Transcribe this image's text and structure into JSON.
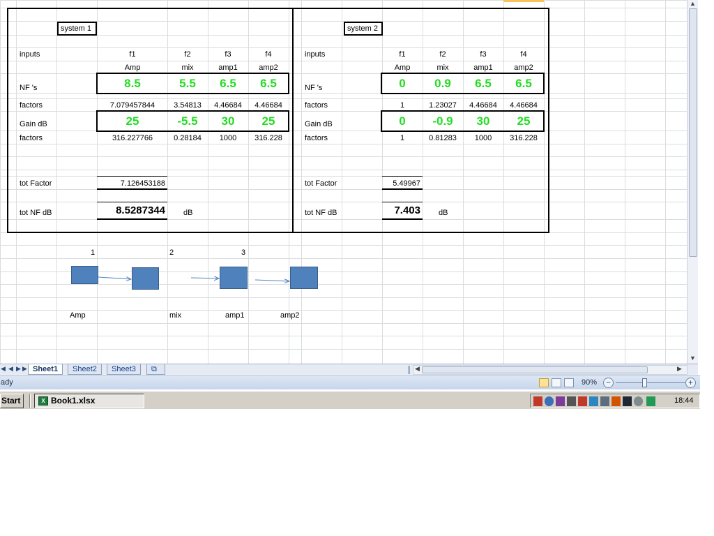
{
  "system1": {
    "title": "system 1",
    "inputs_label": "inputs",
    "headers": [
      "f1",
      "f2",
      "f3",
      "f4"
    ],
    "components": [
      "Amp",
      "mix",
      "amp1",
      "amp2"
    ],
    "nf_label": "NF 's",
    "nf_values": [
      "8.5",
      "5.5",
      "6.5",
      "6.5"
    ],
    "factors_label": "factors",
    "nf_factors": [
      "7.079457844",
      "3.54813",
      "4.46684",
      "4.46684"
    ],
    "gain_label": "Gain dB",
    "gain_values": [
      "25",
      "-5.5",
      "30",
      "25"
    ],
    "gain_factors": [
      "316.227766",
      "0.28184",
      "1000",
      "316.228"
    ],
    "tot_factor_label": "tot Factor",
    "tot_factor_value": "7.126453188",
    "tot_nf_label": "tot NF dB",
    "tot_nf_value": "8.5287344",
    "unit": "dB"
  },
  "system2": {
    "title": "system 2",
    "inputs_label": "inputs",
    "headers": [
      "f1",
      "f2",
      "f3",
      "f4"
    ],
    "components": [
      "Amp",
      "mix",
      "amp1",
      "amp2"
    ],
    "nf_label": "NF 's",
    "nf_values": [
      "0",
      "0.9",
      "6.5",
      "6.5"
    ],
    "factors_label": "factors",
    "nf_factors": [
      "1",
      "1.23027",
      "4.46684",
      "4.46684"
    ],
    "gain_label": "Gain dB",
    "gain_values": [
      "0",
      "-0.9",
      "30",
      "25"
    ],
    "gain_factors": [
      "1",
      "0.81283",
      "1000",
      "316.228"
    ],
    "tot_factor_label": "tot Factor",
    "tot_factor_value": "5.49967",
    "tot_nf_label": "tot NF dB",
    "tot_nf_value": "7.403",
    "unit": "dB"
  },
  "diagram": {
    "numbers": [
      "1",
      "2",
      "3"
    ],
    "labels": [
      "Amp",
      "mix",
      "amp1",
      "amp2"
    ]
  },
  "sheet_tabs": [
    "Sheet1",
    "Sheet2",
    "Sheet3"
  ],
  "active_tab": "Sheet1",
  "status": {
    "ready": "ady",
    "zoom": "90%",
    "zoom_level_percent": 90
  },
  "taskbar": {
    "start": "Start",
    "window": "Book1.xlsx",
    "clock": "18:44"
  },
  "colors": {
    "value_green": "#22dd22",
    "block_blue": "#4f81bd",
    "grid": "#dadcdd"
  }
}
